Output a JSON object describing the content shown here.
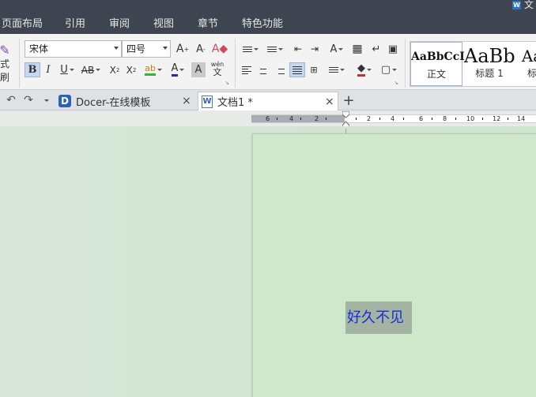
{
  "menubar": {
    "tabs": [
      "页面布局",
      "引用",
      "审阅",
      "视图",
      "章节",
      "特色功能"
    ],
    "title_fragment": "文",
    "app_icon_letter": "W",
    "bg_color": "#3f4550"
  },
  "ribbon": {
    "left_edge_label": "式刷",
    "font_name": "宋体",
    "font_size": "四号",
    "styles": [
      {
        "preview": "AaBbCcI",
        "name": "正文"
      },
      {
        "preview": "AaBb",
        "name": "标题 1"
      },
      {
        "preview": "Aa",
        "name": "标"
      }
    ],
    "phonetic_top": "wén",
    "phonetic_bottom": "文"
  },
  "tabs": {
    "docer_label": "Docer-在线模板",
    "doc_label": "文档1 *",
    "close_glyph": "×",
    "new_tab_glyph": "+"
  },
  "ruler": {
    "labels": [
      "6",
      "4",
      "2",
      "2",
      "4",
      "6",
      "8",
      "10",
      "12",
      "14"
    ]
  },
  "document": {
    "text": "好久不见",
    "text_color": "#1a2ad6",
    "highlight_color": "#a3b5a2",
    "page_color": "#cfe8cc"
  }
}
